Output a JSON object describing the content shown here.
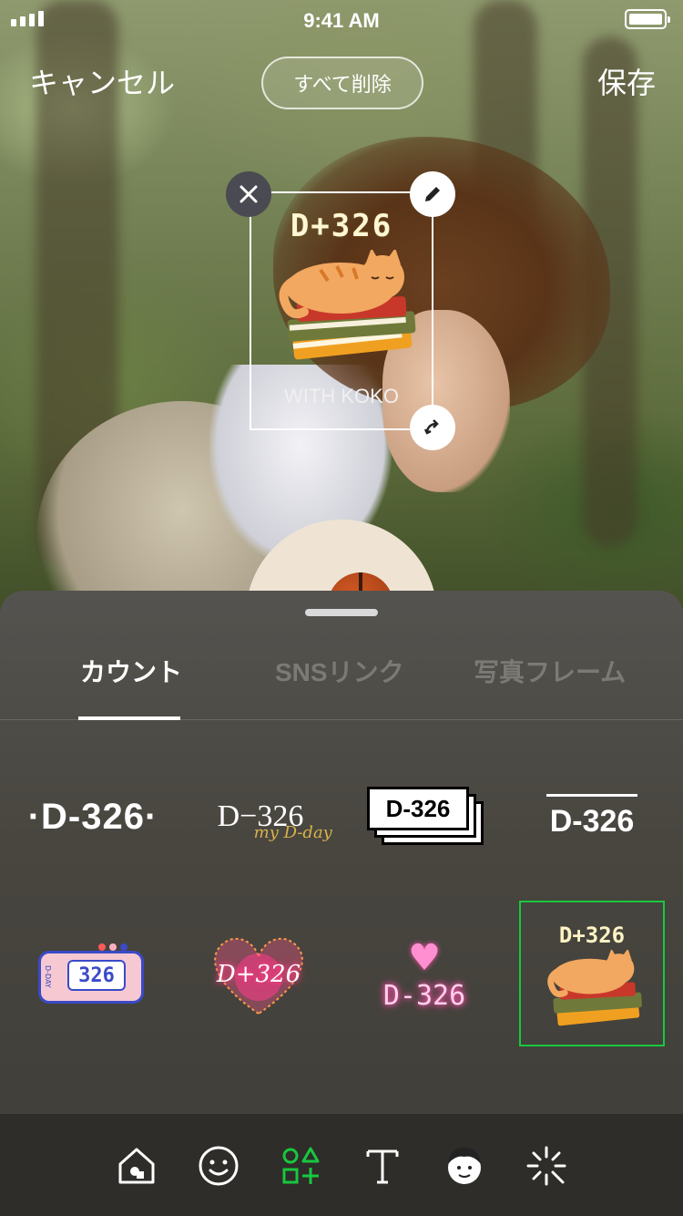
{
  "status": {
    "time": "9:41 AM"
  },
  "nav": {
    "cancel": "キャンセル",
    "clear_all": "すべて削除",
    "save": "保存"
  },
  "sticker": {
    "title": "D+326",
    "footer": "WITH KOKO"
  },
  "tabs": [
    {
      "label": "カウント",
      "active": true
    },
    {
      "label": "SNSリンク",
      "active": false
    },
    {
      "label": "写真フレーム",
      "active": false
    }
  ],
  "stickers": [
    {
      "style": "dot-bold",
      "text": "D-326"
    },
    {
      "style": "serif-script",
      "text": "D−326",
      "sub": "my D-day"
    },
    {
      "style": "stacked-cards",
      "text": "D-326"
    },
    {
      "style": "overline",
      "text": "D-326"
    },
    {
      "style": "alarm-clock",
      "text": "326",
      "side": "D-DAY"
    },
    {
      "style": "firework-heart",
      "text": "D+326"
    },
    {
      "style": "neon-heart",
      "text": "D-326"
    },
    {
      "style": "cat-books",
      "text": "D+326",
      "selected": true
    }
  ],
  "colors": {
    "accent": "#18c73e",
    "panel": "#4a4843",
    "toolbar": "#2e2d2a",
    "tab_inactive": "#7c7a75"
  },
  "toolbar": [
    {
      "icon": "home-sticker-icon"
    },
    {
      "icon": "smiley-icon"
    },
    {
      "icon": "shapes-add-icon",
      "active": true
    },
    {
      "icon": "text-icon"
    },
    {
      "icon": "face-icon"
    },
    {
      "icon": "sparkle-effect-icon"
    }
  ]
}
